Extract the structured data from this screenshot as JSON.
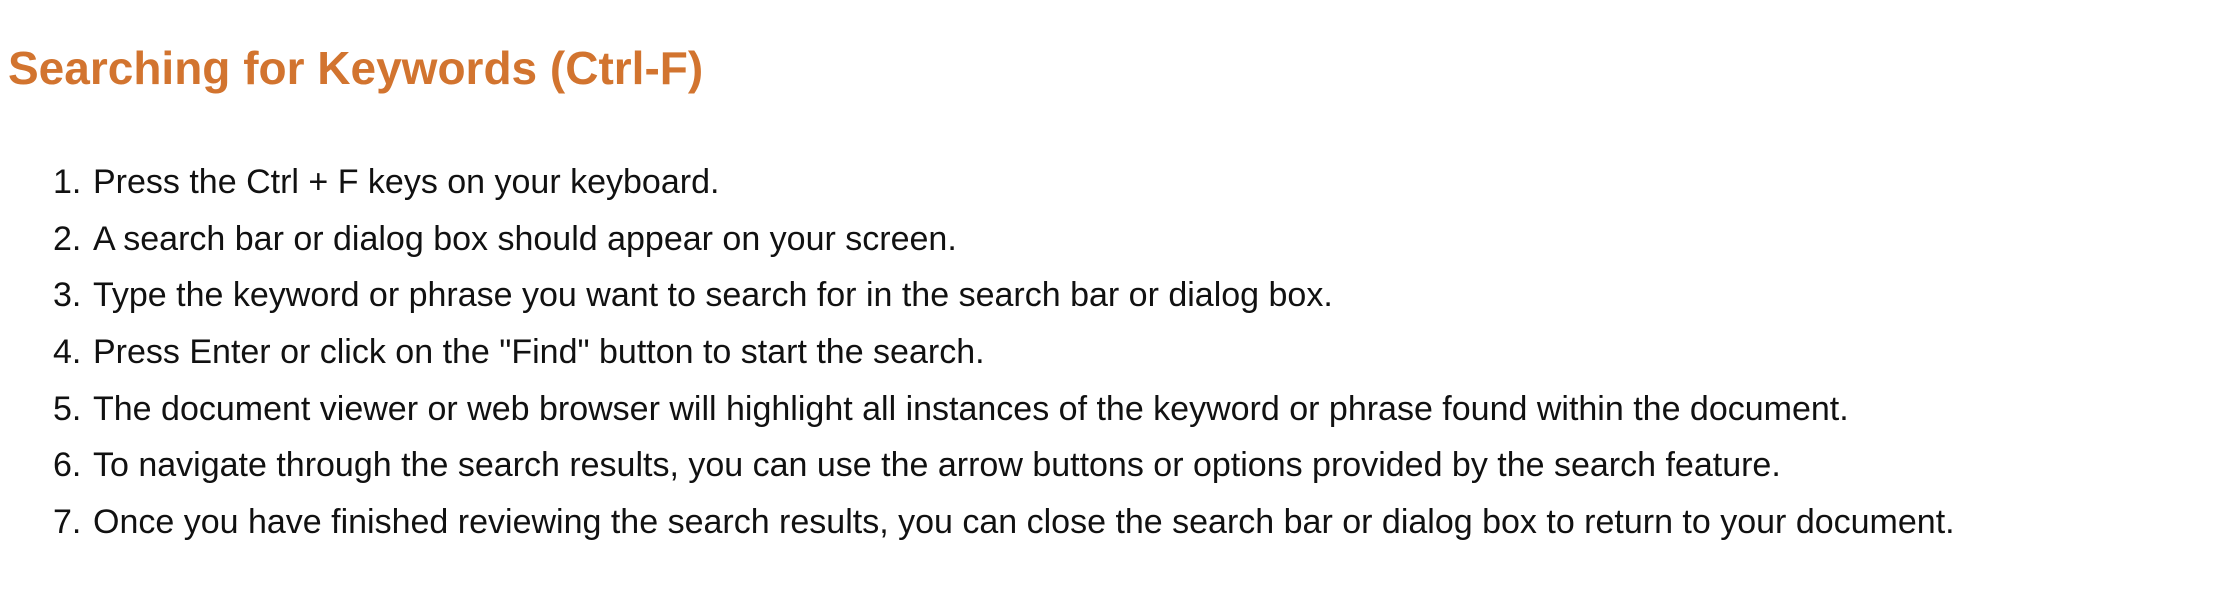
{
  "heading": "Searching for Keywords (Ctrl-F)",
  "accent_color": "#D2742F",
  "steps": [
    {
      "number": "1.",
      "text": "Press the Ctrl + F keys on your keyboard."
    },
    {
      "number": "2.",
      "text": "A search bar or dialog box should appear on your screen."
    },
    {
      "number": "3.",
      "text": "Type the keyword or phrase you want to search for in the search bar or dialog box."
    },
    {
      "number": "4.",
      "text": "Press Enter or click on the \"Find\" button to start the search."
    },
    {
      "number": "5.",
      "text": "The document viewer or web browser will highlight all instances of the keyword or phrase found within the document."
    },
    {
      "number": "6.",
      "text": "To navigate through the search results, you can use the arrow buttons or options provided by the search feature."
    },
    {
      "number": "7.",
      "text": "Once you have finished reviewing the search results, you can close the search bar or dialog box to return to your document."
    }
  ]
}
